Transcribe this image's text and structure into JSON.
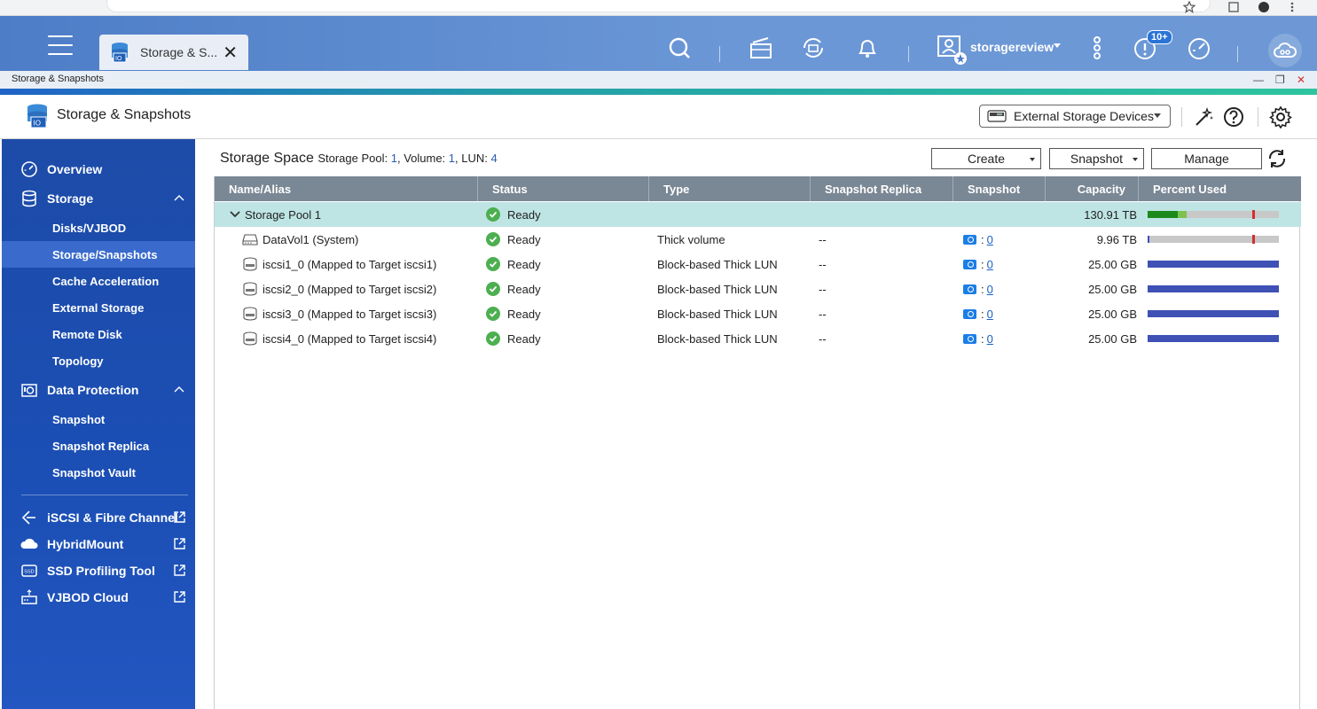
{
  "browser": {},
  "topbar": {
    "tab_label": "Storage & S...",
    "username": "storagereview",
    "notification_badge": "10+"
  },
  "window": {
    "title": "Storage & Snapshots"
  },
  "app": {
    "title": "Storage & Snapshots",
    "external_button": "External Storage Devices"
  },
  "sidebar": {
    "overview": "Overview",
    "storage": "Storage",
    "storage_items": [
      "Disks/VJBOD",
      "Storage/Snapshots",
      "Cache Acceleration",
      "External Storage",
      "Remote Disk",
      "Topology"
    ],
    "data_protection": "Data Protection",
    "dp_items": [
      "Snapshot",
      "Snapshot Replica",
      "Snapshot Vault"
    ],
    "links": [
      "iSCSI & Fibre Channel",
      "HybridMount",
      "SSD Profiling Tool",
      "VJBOD Cloud"
    ]
  },
  "main": {
    "title": "Storage Space",
    "stats_pool_label": "Storage Pool:",
    "stats_pool": "1",
    "stats_volume_label": "Volume:",
    "stats_volume": "1",
    "stats_lun_label": "LUN:",
    "stats_lun": "4",
    "buttons": {
      "create": "Create",
      "snapshot": "Snapshot",
      "manage": "Manage"
    }
  },
  "table": {
    "headers": [
      "Name/Alias",
      "Status",
      "Type",
      "Snapshot Replica",
      "Snapshot",
      "Capacity",
      "Percent Used"
    ],
    "pool": {
      "name": "Storage Pool 1",
      "status": "Ready",
      "capacity": "130.91 TB",
      "used_green": 0.23,
      "used_lightgreen": 0.07,
      "threshold": 0.8
    },
    "rows": [
      {
        "name": "DataVol1 (System)",
        "status": "Ready",
        "type": "Thick volume",
        "replica": "--",
        "snap_count": "0",
        "capacity": "9.96 TB",
        "used": 0.01,
        "threshold": 0.8,
        "icon": "volume"
      },
      {
        "name": "iscsi1_0 (Mapped to Target iscsi1)",
        "status": "Ready",
        "type": "Block-based Thick LUN",
        "replica": "--",
        "snap_count": "0",
        "capacity": "25.00 GB",
        "used": 1.0,
        "icon": "lun"
      },
      {
        "name": "iscsi2_0 (Mapped to Target iscsi2)",
        "status": "Ready",
        "type": "Block-based Thick LUN",
        "replica": "--",
        "snap_count": "0",
        "capacity": "25.00 GB",
        "used": 1.0,
        "icon": "lun"
      },
      {
        "name": "iscsi3_0 (Mapped to Target iscsi3)",
        "status": "Ready",
        "type": "Block-based Thick LUN",
        "replica": "--",
        "snap_count": "0",
        "capacity": "25.00 GB",
        "used": 1.0,
        "icon": "lun"
      },
      {
        "name": "iscsi4_0 (Mapped to Target iscsi4)",
        "status": "Ready",
        "type": "Block-based Thick LUN",
        "replica": "--",
        "snap_count": "0",
        "capacity": "25.00 GB",
        "used": 1.0,
        "icon": "lun"
      }
    ]
  },
  "colors": {
    "sidebar": "#1d4ba8",
    "pool_row": "#bfe4e4",
    "header": "#7a8794",
    "bar_used": "#3f51b5",
    "bar_green": "#1b8a1b",
    "bar_lightgreen": "#7cc24e",
    "threshold": "#d32f2f",
    "link": "#1a5fc2"
  }
}
